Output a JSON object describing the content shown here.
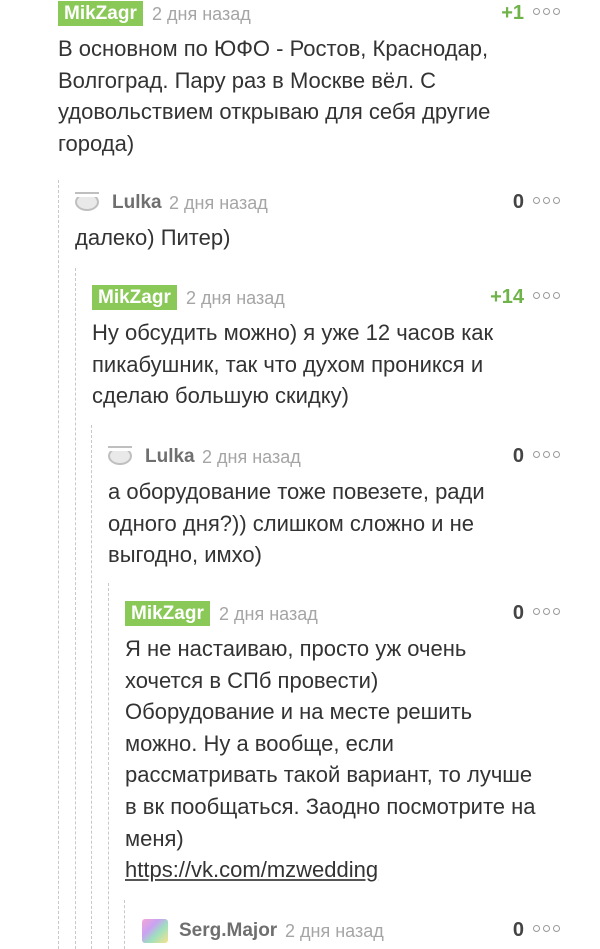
{
  "comments": [
    {
      "author": "MikZagr",
      "date": "2 дня назад",
      "rating": "+1",
      "lines": [
        "В основном по ЮФО - Ростов, Краснодар,",
        "Волгоград. Пару раз в Москве вёл. С",
        "удовольствием открываю для себя другие",
        "города)"
      ]
    },
    {
      "author": "Lulka",
      "date": "2 дня назад",
      "rating": "0",
      "lines": [
        "далеко) Питер)"
      ]
    },
    {
      "author": "MikZagr",
      "date": "2 дня назад",
      "rating": "+14",
      "lines": [
        "Ну обсудить можно) я уже 12 часов как",
        "пикабушник, так что духом проникся и",
        "сделаю большую скидку)"
      ]
    },
    {
      "author": "Lulka",
      "date": "2 дня назад",
      "rating": "0",
      "lines": [
        "а оборудование тоже повезете, ради",
        "одного дня?)) слишком сложно и не",
        "выгодно, имхо)"
      ]
    },
    {
      "author": "MikZagr",
      "date": "2 дня назад",
      "rating": "0",
      "lines": [
        "Я не настаиваю, просто уж очень",
        "хочется в СПб провести)",
        "Оборудование и на месте решить",
        "можно. Ну а вообще, если",
        "рассматривать такой вариант, то лучше",
        "в вк пообщаться. Заодно посмотрите на",
        "меня)"
      ],
      "link": "https://vk.com/mzwedding"
    },
    {
      "author": "Serg.Major",
      "date": "2 дня назад",
      "rating": "0",
      "lines": []
    }
  ],
  "colors": {
    "accent_green": "#8ac858",
    "positive_rating": "#70b34a",
    "date_gray": "#a5a5a5"
  }
}
